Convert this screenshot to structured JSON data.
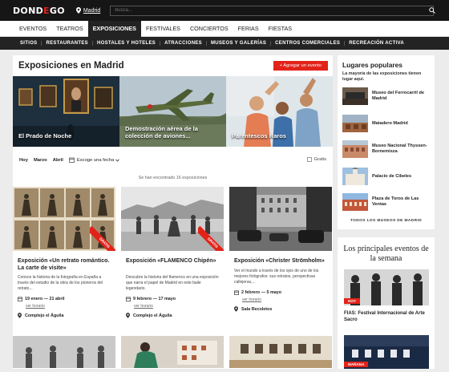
{
  "header": {
    "logo_text": "DONDEGO",
    "city": "Madrid",
    "search_placeholder": "Busca..."
  },
  "main_nav": [
    "EVENTOS",
    "TEATROS",
    "EXPOSICIONES",
    "FESTIVALES",
    "CONCIERTOS",
    "FERIAS",
    "FIESTAS"
  ],
  "main_nav_active": "EXPOSICIONES",
  "sub_nav": [
    "SITIOS",
    "RESTAURANTES",
    "HOSTALES Y HOTELES",
    "ATRACCIONES",
    "MUSEOS Y GALERÍAS",
    "CENTROS COMERCIALES",
    "RECREACIÓN ACTIVA"
  ],
  "main": {
    "title": "Exposiciones en Madrid",
    "add_button": "+ Agregar un evento",
    "hero": [
      {
        "label": "El Prado de Noche"
      },
      {
        "label": "Demostración aérea de la colección de aviones..."
      },
      {
        "label": "Parentescos Raros"
      }
    ],
    "filters": {
      "today": "Hoy",
      "month1": "Marzo",
      "month2": "Abril",
      "date_picker": "Escoge una fecha",
      "free": "Gratis"
    },
    "results_count": "Se han encontrado 16 exposiciones",
    "cards": [
      {
        "title": "Exposición «Un retrato romántico. La carte de visite»",
        "desc": "Conoce la historia de la fotografía en España a través del estudio de la obra de los pioneros del retrato...",
        "date": "19 enero — 21 abril",
        "more": "ver horario",
        "place": "Complejo el Águila",
        "ribbon": "GRATIS"
      },
      {
        "title": "Exposición «FLAMENCO Chipén»",
        "desc": "Descubre la historia del flamenco en una exposición que narra el papel de Madrid en este baile legendario.",
        "date": "9 febrero — 17 mayo",
        "more": "ver horario",
        "place": "Complejo el Águila",
        "ribbon": "GRATIS"
      },
      {
        "title": "Exposición «Christer Strömholm»",
        "desc": "Ver el mundo a través de los ojos de uno de los mejores fotógrafos: sus retratos, perspectivas callejeras,...",
        "date": "2 febrero — 5 mayo",
        "more": "ver horario",
        "place": "Sala Recoletos",
        "ribbon": ""
      }
    ]
  },
  "sidebar": {
    "title": "Lugares populares",
    "subtitle": "La mayoría de las exposiciones tienen lugar aquí.",
    "places": [
      {
        "label": "Museo del Ferrocarril de Madrid"
      },
      {
        "label": "Matadero Madrid"
      },
      {
        "label": "Museo Nacional Thyssen-Bornemisza"
      },
      {
        "label": "Palacio de Cibeles"
      },
      {
        "label": "Plaza de Toros de Las Ventas"
      }
    ],
    "all_link": "TODOS LOS MUSEOS DE MADRID"
  },
  "events": {
    "title": "Los principales eventos de la semana",
    "items": [
      {
        "badge": "HOY",
        "title": "FIAS: Festival Internacional de Arte Sacro"
      },
      {
        "badge": "MAÑANA"
      }
    ]
  },
  "colors": {
    "accent": "#e2231a",
    "dark": "#161616"
  }
}
